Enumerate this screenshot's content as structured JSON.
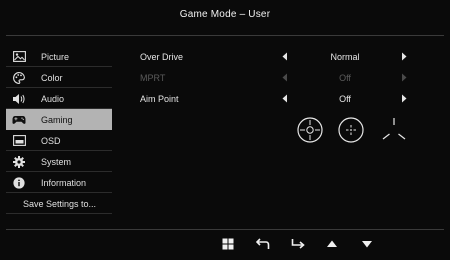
{
  "header": {
    "title": "Game Mode – User"
  },
  "sidebar": {
    "items": [
      {
        "label": "Picture",
        "icon": "picture-icon"
      },
      {
        "label": "Color",
        "icon": "color-palette-icon"
      },
      {
        "label": "Audio",
        "icon": "speaker-icon"
      },
      {
        "label": "Gaming",
        "icon": "gamepad-icon",
        "active": true
      },
      {
        "label": "OSD",
        "icon": "osd-window-icon"
      },
      {
        "label": "System",
        "icon": "gear-icon"
      },
      {
        "label": "Information",
        "icon": "info-icon"
      }
    ],
    "save": {
      "label": "Save Settings to..."
    }
  },
  "settings": {
    "rows": [
      {
        "label": "Over Drive",
        "value": "Normal",
        "enabled": true
      },
      {
        "label": "MPRT",
        "value": "Off",
        "enabled": false
      },
      {
        "label": "Aim Point",
        "value": "Off",
        "enabled": true
      }
    ],
    "aim_point_options": [
      "crosshair-circle-icon",
      "crosshair-dot-icon",
      "crosshair-tri-icon"
    ]
  },
  "footer": {
    "keys": [
      "menu-grid-icon",
      "back-icon",
      "enter-icon",
      "up-icon",
      "down-icon"
    ]
  },
  "colors": {
    "background": "#0a0a0a",
    "active_item_bg": "#b3b3b3",
    "text": "#e6e6e6",
    "disabled_text": "#5b5b5b"
  }
}
